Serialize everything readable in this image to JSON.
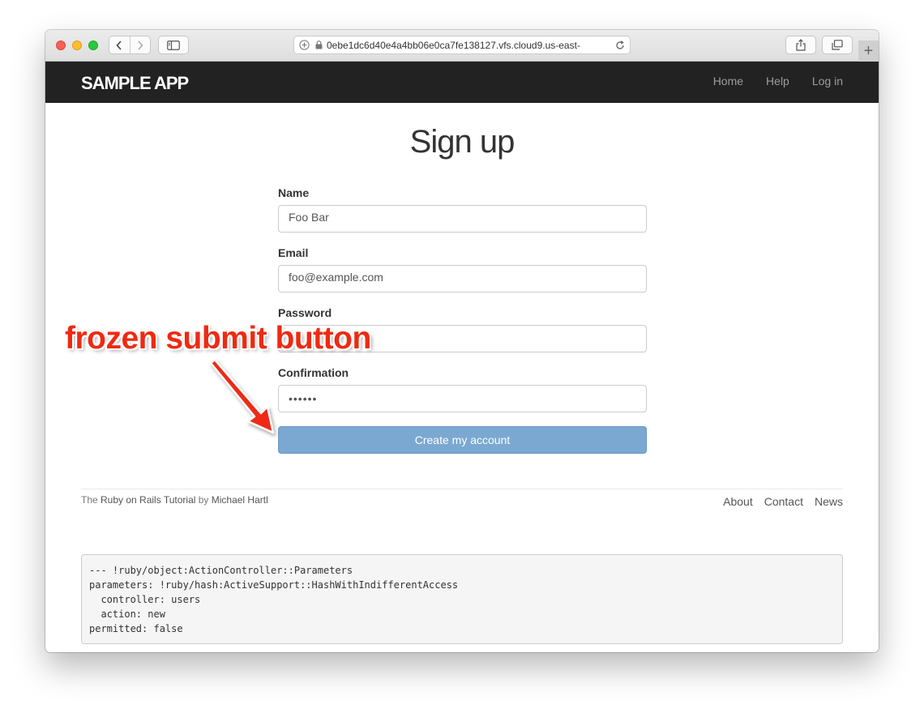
{
  "browser": {
    "url": "0ebe1dc6d40e4a4bb06e0ca7fe138127.vfs.cloud9.us-east-",
    "new_tab_label": "+"
  },
  "navbar": {
    "logo": "Sample App",
    "links": [
      "Home",
      "Help",
      "Log in"
    ]
  },
  "form": {
    "title": "Sign up",
    "name_label": "Name",
    "name_value": "Foo Bar",
    "email_label": "Email",
    "email_value": "foo@example.com",
    "password_label": "Password",
    "password_value": "",
    "confirmation_label": "Confirmation",
    "confirmation_value": "••••••",
    "submit_label": "Create my account",
    "submit_color": "#7aa8d1"
  },
  "footer": {
    "prefix": "The ",
    "tutorial_link": "Ruby on Rails Tutorial",
    "by": " by ",
    "author_link": "Michael Hartl",
    "links": [
      "About",
      "Contact",
      "News"
    ]
  },
  "debug": {
    "text": "--- !ruby/object:ActionController::Parameters\nparameters: !ruby/hash:ActiveSupport::HashWithIndifferentAccess\n  controller: users\n  action: new\npermitted: false"
  },
  "annotation": {
    "text": "frozen submit button",
    "color": "#ee2a12"
  }
}
